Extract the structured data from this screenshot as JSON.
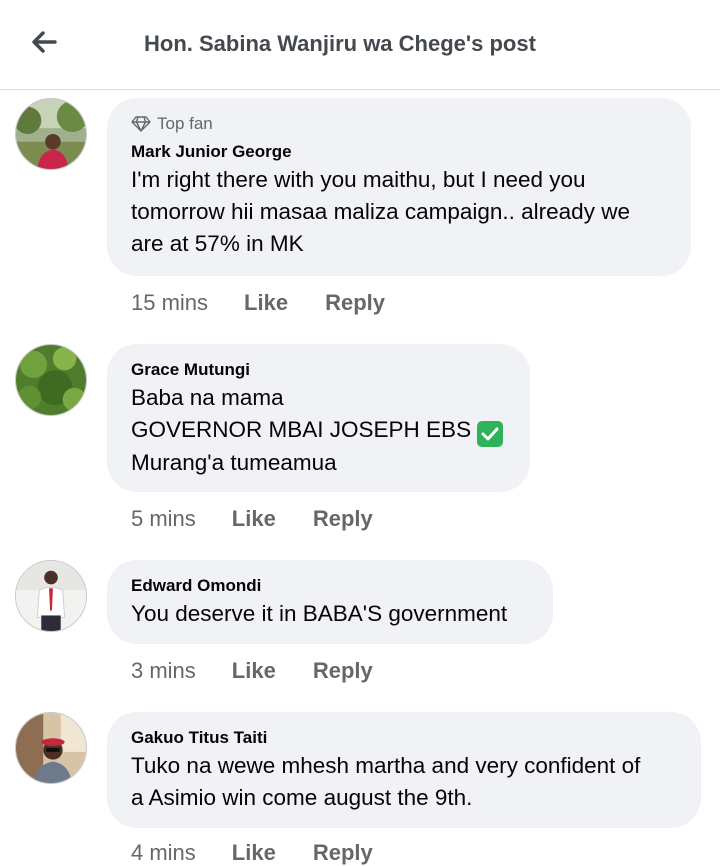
{
  "header": {
    "title": "Hon. Sabina Wanjiru wa Chege's post"
  },
  "comments": [
    {
      "badge": "Top fan",
      "author": "Mark Junior George",
      "text": "I'm right there with you maithu, but I need you\ntomorrow hii masaa maliza campaign.. already we\nare at 57% in MK",
      "time": "15 mins",
      "like": "Like",
      "reply": "Reply"
    },
    {
      "author": "Grace Mutungi",
      "text": "Baba na mama\nGOVERNOR MBAI JOSEPH EBS",
      "text_end": "\nMurang'a tumeamua",
      "emoji": "check-mark-button",
      "time": "5 mins",
      "like": "Like",
      "reply": "Reply"
    },
    {
      "author": "Edward Omondi",
      "text": "You deserve it in BABA'S government",
      "time": "3 mins",
      "like": "Like",
      "reply": "Reply"
    },
    {
      "author": "Gakuo Titus Taiti",
      "text": "Tuko na wewe mhesh martha and very confident of\na Asimio win come august the 9th.",
      "time": "4 mins",
      "like": "Like",
      "reply": "Reply"
    }
  ],
  "icons": {
    "back": "arrow-left-icon",
    "badge": "diamond-icon"
  },
  "colors": {
    "bubble": "#f0f2f5",
    "meta": "#65676b",
    "emoji": "#2fb25a"
  }
}
